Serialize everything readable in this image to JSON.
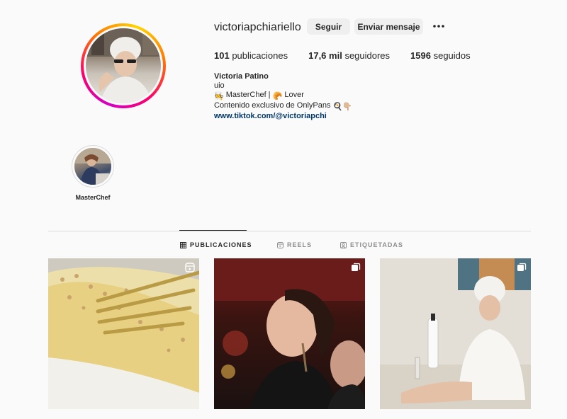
{
  "profile": {
    "username": "victoriapchiariello",
    "follow_label": "Seguir",
    "message_label": "Enviar mensaje",
    "more_icon": "ellipsis-icon"
  },
  "stats": {
    "posts_count": "101",
    "posts_label": "publicaciones",
    "followers_count": "17,6 mil",
    "followers_label": "seguidores",
    "following_count": "1596",
    "following_label": "seguidos"
  },
  "bio": {
    "name": "Victoria Patino",
    "line1": "uio",
    "line2_prefix": "🧑‍🍳",
    "line2_text": "MasterChef |",
    "line2_emoji": "🥐",
    "line2_suffix": "Lover",
    "line3_text": "Contenido exclusivo de OnlyPans",
    "line3_emoji": "🍳👇🏼",
    "link": "www.tiktok.com/@victoriapchi"
  },
  "highlights": [
    {
      "label": "MasterChef"
    }
  ],
  "tabs": [
    {
      "label": "PUBLICACIONES",
      "icon": "grid-icon",
      "active": true
    },
    {
      "label": "REELS",
      "icon": "reels-icon",
      "active": false
    },
    {
      "label": "ETIQUETADAS",
      "icon": "tagged-icon",
      "active": false
    }
  ],
  "posts": [
    {
      "type": "reel",
      "badge_icon": "reel-badge-icon"
    },
    {
      "type": "carousel",
      "badge_icon": "carousel-badge-icon"
    },
    {
      "type": "carousel",
      "badge_icon": "carousel-badge-icon"
    }
  ],
  "colors": {
    "background": "#fafafa",
    "button_bg": "#efefef",
    "link": "#00376b",
    "muted": "#8e8e8e",
    "divider": "#dbdbdb"
  }
}
